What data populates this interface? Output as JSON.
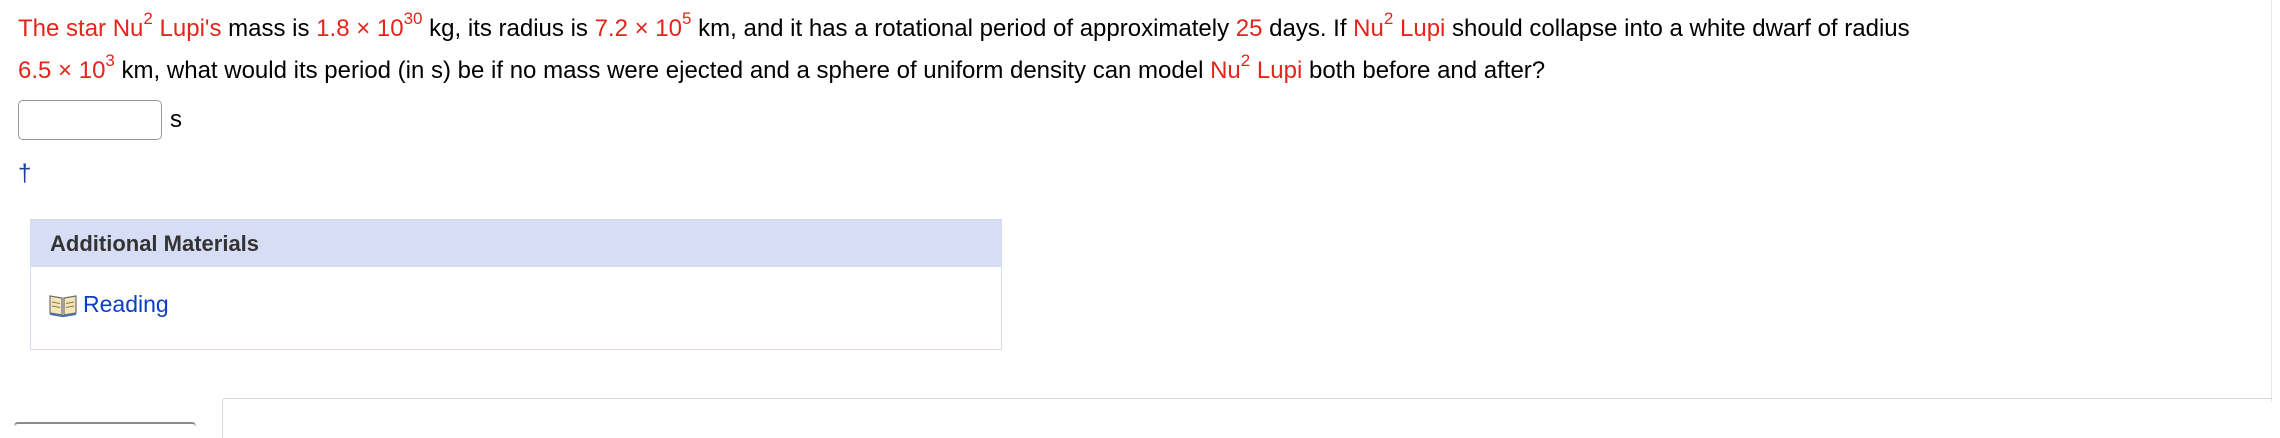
{
  "question": {
    "p1": "The star Nu",
    "p1_sup": "2",
    "p2": " Lupi's",
    "p3": " mass is ",
    "mass_base": "1.8 × 10",
    "mass_exp": "30",
    "p4": " kg, its radius is ",
    "radius_base": "7.2 × 10",
    "radius_exp": "5",
    "p5": " km, and it has a rotational period of approximately ",
    "period": "25",
    "p6": " days. If ",
    "star2": "Nu",
    "star2_sup": "2",
    "star2_rest": " Lupi",
    "p7": " should collapse into a white dwarf of radius",
    "wd_base": "6.5 × 10",
    "wd_exp": "3",
    "p8": " km, what would its period (in s) be if no mass were ejected and a sphere of uniform density can model ",
    "star3": "Nu",
    "star3_sup": "2",
    "star3_rest": " Lupi",
    "p9": " both before and after?"
  },
  "answer": {
    "value": "",
    "unit": "s"
  },
  "dagger": "†",
  "materials": {
    "header": "Additional Materials",
    "reading_label": "Reading",
    "icon": "book-icon"
  },
  "colors": {
    "highlight": "#e4251b",
    "link": "#0b3ec9",
    "header_bg": "#d7ddf4"
  }
}
